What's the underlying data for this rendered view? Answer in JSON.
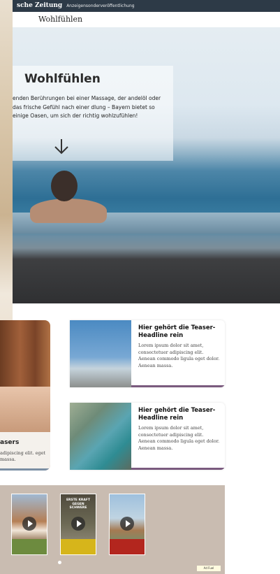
{
  "topbar": {
    "brand": "sche Zeitung",
    "sub": "Anzeigensonderveröffentlichung"
  },
  "navbar": {
    "logo": "Wohlfühlen"
  },
  "hero": {
    "title": "Wohlfühlen",
    "intro": "enden Berührungen bei einer Massage, der andelöl oder das frische Gefühl nach einer dlung – Bayern bietet so einige Oasen, um sich der richtig wohlzufühlen!"
  },
  "left_card": {
    "title": "asers",
    "text": "adipiscing elit. eget massa."
  },
  "teasers": [
    {
      "title": "Hier gehört die Teaser-Headline rein",
      "text": "Lorem ipsum dolor sit amet, consectetuer adipiscing elit. Aenean commodo ligula eget dolor. Aenean massa."
    },
    {
      "title": "Hier gehört die Teaser-Headline rein",
      "text": "Lorem ipsum dolor sit amet, consectetuer adipiscing elit. Aenean commodo ligula eget dolor. Aenean massa."
    }
  ],
  "videos": [
    {
      "label": ""
    },
    {
      "top": "ERSTE KRAFT GEGEN SCHWERE",
      "label": ""
    },
    {
      "label": ""
    }
  ],
  "ad_badge": "Ad Fuel",
  "colors": {
    "topbar": "#2d3a47",
    "teaser_bar": "#7a5a7e",
    "video_bg": "#c9bcb1"
  }
}
